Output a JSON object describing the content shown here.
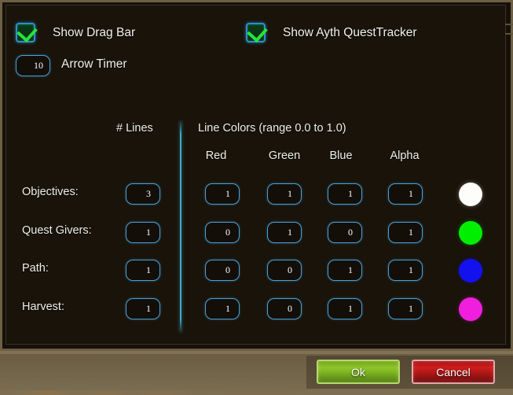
{
  "dialog": {
    "toggles": [
      {
        "label": "Show Drag Bar",
        "checked": true,
        "icon": "checkbox-checked-icon"
      },
      {
        "label": "Show Ayth QuestTracker",
        "checked": true,
        "icon": "checkbox-checked-icon"
      }
    ],
    "arrow_timer": {
      "label": "Arrow Timer",
      "value": "10"
    },
    "headers": {
      "lines": "# Lines",
      "colors": "Line Colors (range 0.0 to 1.0)"
    },
    "columns": [
      "Red",
      "Green",
      "Blue",
      "Alpha"
    ],
    "rows": [
      {
        "label": "Objectives:",
        "lines": "3",
        "red": "1",
        "green": "1",
        "blue": "1",
        "alpha": "1",
        "swatch": "#fdfdfa"
      },
      {
        "label": "Quest Givers:",
        "lines": "1",
        "red": "0",
        "green": "1",
        "blue": "0",
        "alpha": "1",
        "swatch": "#00ef00"
      },
      {
        "label": "Path:",
        "lines": "1",
        "red": "0",
        "green": "0",
        "blue": "1",
        "alpha": "1",
        "swatch": "#1312ef"
      },
      {
        "label": "Harvest:",
        "lines": "1",
        "red": "1",
        "green": "0",
        "blue": "1",
        "alpha": "1",
        "swatch": "#ef1fdd"
      }
    ],
    "buttons": {
      "ok": "Ok",
      "cancel": "Cancel"
    },
    "colors": {
      "field_border": "#4a9fd6",
      "divider": "#3fa8c4",
      "panel_bg": "#191309",
      "frame": "#6d5f44",
      "ok_accent": "#8fc52a",
      "cancel_accent": "#cf1d1d"
    }
  }
}
